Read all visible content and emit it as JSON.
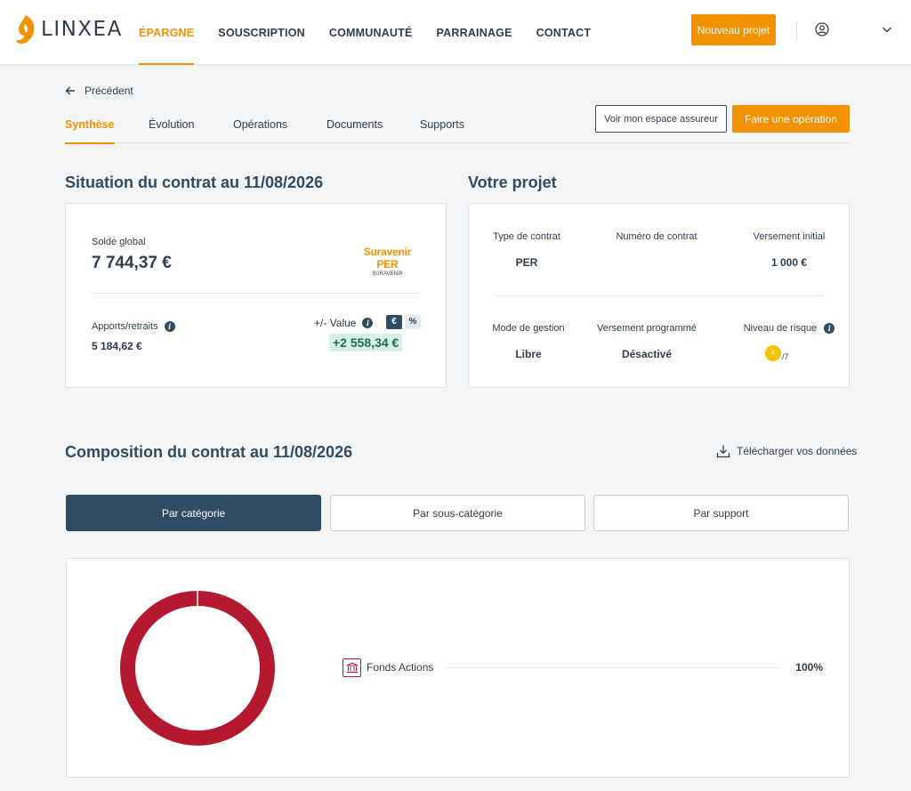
{
  "brand": {
    "name": "LINXEA",
    "accent": "#f39200",
    "navy": "#2f4c63"
  },
  "nav": {
    "items": [
      "ÉPARGNE",
      "SOUSCRIPTION",
      "COMMUNAUTÉ",
      "PARRAINAGE",
      "CONTACT"
    ],
    "active": "ÉPARGNE",
    "new_project_label": "Nouveau projet",
    "icons": [
      "user-circle-icon",
      "chevron-down-icon"
    ]
  },
  "page": {
    "back_label": "Précédent",
    "tabs": [
      "Synthèse",
      "Évolution",
      "Opérations",
      "Documents",
      "Supports"
    ],
    "active_tab": "Synthèse",
    "insurer_space_label": "Voir mon espace assureur",
    "operation_label": "Faire une opération"
  },
  "situation": {
    "title": "Situation du contrat au 11/08/2026",
    "solde_label": "Solde global",
    "solde_value": "7 744,37 €",
    "partner_logo": "Suravenir PER",
    "partner_sub": "SURAVENIR",
    "apports_label": "Apports/retraits",
    "apports_value": "5 184,62 €",
    "value_label": "+/- Value",
    "toggle_euro": "€",
    "toggle_pct": "%",
    "value_amount": "+2 558,34 €"
  },
  "projet": {
    "title": "Votre projet",
    "type_label": "Type de contrat",
    "type_value": "PER",
    "numero_label": "Numéro de contrat",
    "numero_value": "",
    "versement_initial_label": "Versement initial",
    "versement_initial_value": "1 000 €",
    "gestion_label": "Mode de gestion",
    "gestion_value": "Libre",
    "programme_label": "Versement programmé",
    "programme_value": "Désactivé",
    "risque_label": "Niveau de risque",
    "risque_value": "4",
    "risque_max": "/7",
    "risque_color": "#f5c400"
  },
  "composition": {
    "title": "Composition du contrat au 11/08/2026",
    "download_label": "Télécharger vos données",
    "segments": [
      "Par catégorie",
      "Par sous-catégorie",
      "Par support"
    ],
    "active_segment": "Par catégorie"
  },
  "chart_data": {
    "type": "pie",
    "categories": [
      "Fonds Actions"
    ],
    "values": [
      100
    ],
    "value_labels": [
      "100%"
    ],
    "colors": [
      "#b5192f"
    ],
    "donut": true,
    "legend_placement": "right"
  }
}
